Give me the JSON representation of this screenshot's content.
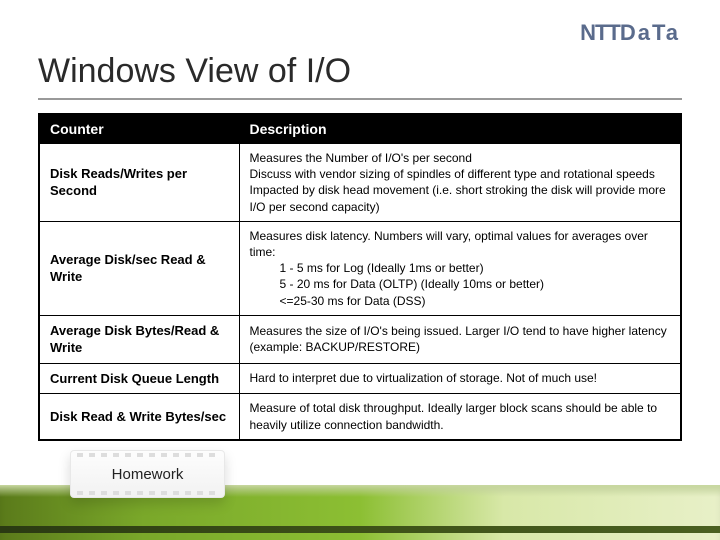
{
  "brand": {
    "part1": "NTT",
    "part2": "DaTa"
  },
  "title": "Windows View of I/O",
  "table": {
    "headers": {
      "col1": "Counter",
      "col2": "Description"
    },
    "rows": [
      {
        "counter": "Disk Reads/Writes per Second",
        "desc": "Measures the Number of I/O's per second\nDiscuss with vendor sizing of spindles of different type and rotational speeds\nImpacted by disk head movement (i.e. short stroking the disk will provide more I/O per second capacity)"
      },
      {
        "counter": "Average Disk/sec Read & Write",
        "desc_pre": "Measures disk latency. Numbers will vary, optimal values for averages over time:",
        "desc_items": [
          "1 - 5 ms for Log (Ideally 1ms or better)",
          "5 - 20 ms for Data (OLTP) (Ideally 10ms or better)",
          "<=25-30 ms for Data (DSS)"
        ]
      },
      {
        "counter": "Average Disk Bytes/Read & Write",
        "desc": "Measures the size of I/O's being issued.  Larger I/O tend to have higher latency (example: BACKUP/RESTORE)"
      },
      {
        "counter": "Current Disk Queue Length",
        "desc": "Hard to interpret due to virtualization of storage. Not of much use!"
      },
      {
        "counter": "Disk Read & Write Bytes/sec",
        "desc": "Measure of total disk throughput.  Ideally larger block scans should be able to heavily utilize connection bandwidth."
      }
    ]
  },
  "homework_label": "Homework"
}
